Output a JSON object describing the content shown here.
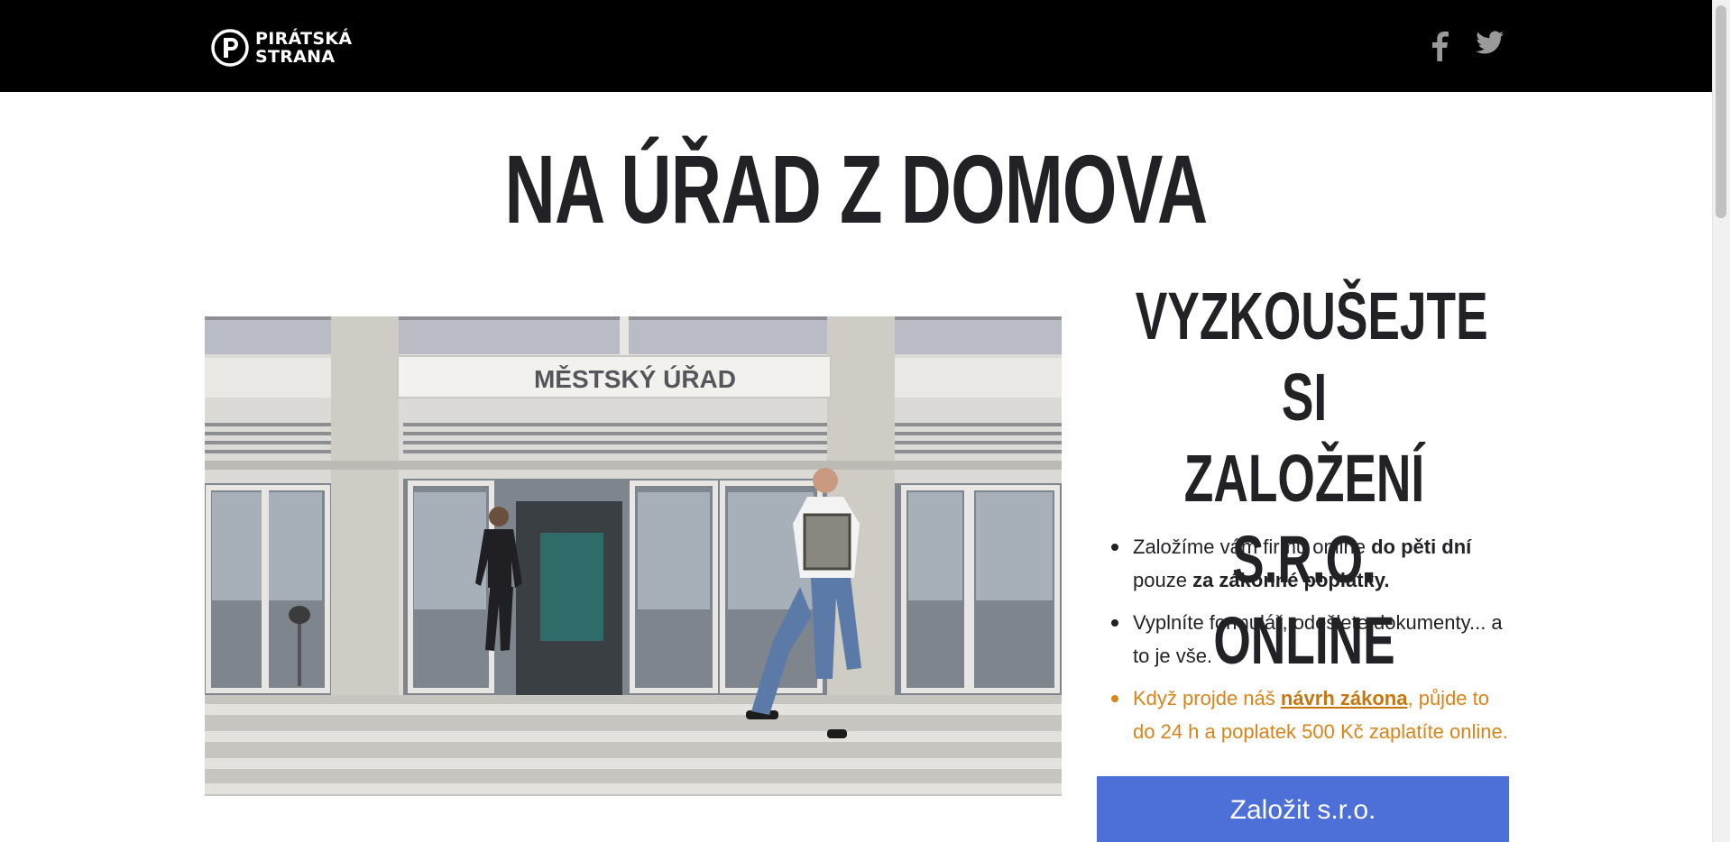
{
  "header": {
    "logo_line1": "PIRÁTSKÁ",
    "logo_line2": "STRANA",
    "social": [
      {
        "name": "facebook",
        "icon": "facebook-icon"
      },
      {
        "name": "twitter",
        "icon": "twitter-icon"
      }
    ]
  },
  "hero": {
    "title": "NA ÚŘAD Z DOMOVA"
  },
  "video": {
    "sign_text": "MĚSTSKÝ ÚŘAD"
  },
  "sidebar": {
    "title_line1": "VYZKOUŠEJTE SI",
    "title_line2": "ZALOŽENÍ S.R.O.",
    "title_line3": "ONLINE",
    "benefits": [
      {
        "pre": "Založíme vám firmu online ",
        "bold1": "do pěti dní",
        "mid": " pouze ",
        "bold2": "za zákonné poplatky."
      },
      {
        "text": "Vyplníte formulář, odešlete dokumenty... a to je vše."
      },
      {
        "pre": "Když projde náš ",
        "link": "návrh zákona",
        "post": ", půjde to do 24 h a poplatek 500 Kč zaplatíte online."
      }
    ],
    "cta_label": "Založit s.r.o."
  },
  "colors": {
    "topbar": "#000000",
    "highlight": "#d98419",
    "cta": "#4d6fd8",
    "text": "#222226"
  }
}
